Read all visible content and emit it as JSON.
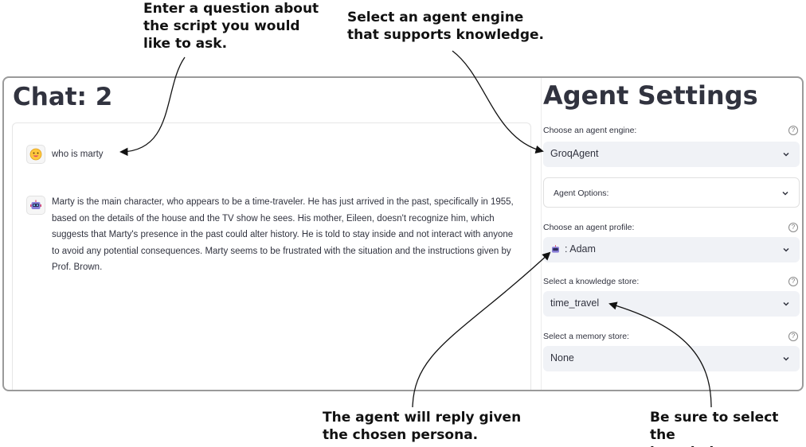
{
  "annotations": {
    "question": "Enter a question about\nthe script you would\nlike to ask.",
    "engine": "Select an agent engine\nthat supports knowledge.",
    "persona": "The agent will reply given\nthe chosen persona.",
    "store": "Be sure to select the\nknowledge store."
  },
  "chat": {
    "title": "Chat: 2",
    "messages": [
      {
        "role": "user",
        "avatar_icon": "user-face-icon",
        "text": "who is marty"
      },
      {
        "role": "assistant",
        "avatar_icon": "robot-icon",
        "text": "Marty is the main character, who appears to be a time-traveler. He has just arrived in the past, specifically in 1955, based on the details of the house and the TV show he sees. His mother, Eileen, doesn't recognize him, which suggests that Marty's presence in the past could alter history. He is told to stay inside and not interact with anyone to avoid any potential consequences. Marty seems to be frustrated with the situation and the instructions given by Prof. Brown."
      }
    ]
  },
  "settings": {
    "title": "Agent Settings",
    "help_icon": "question-circle-icon",
    "engine": {
      "label": "Choose an agent engine:",
      "value": "GroqAgent"
    },
    "options": {
      "label": "Agent Options:"
    },
    "profile": {
      "label": "Choose an agent profile:",
      "value": ": Adam",
      "icon": "robot-icon"
    },
    "knowledge": {
      "label": "Select a knowledge store:",
      "value": "time_travel"
    },
    "memory": {
      "label": "Select a memory store:",
      "value": "None"
    }
  },
  "colors": {
    "select_bg": "#f0f2f6",
    "text": "#31333f",
    "frame_border": "#9a9a9a"
  }
}
